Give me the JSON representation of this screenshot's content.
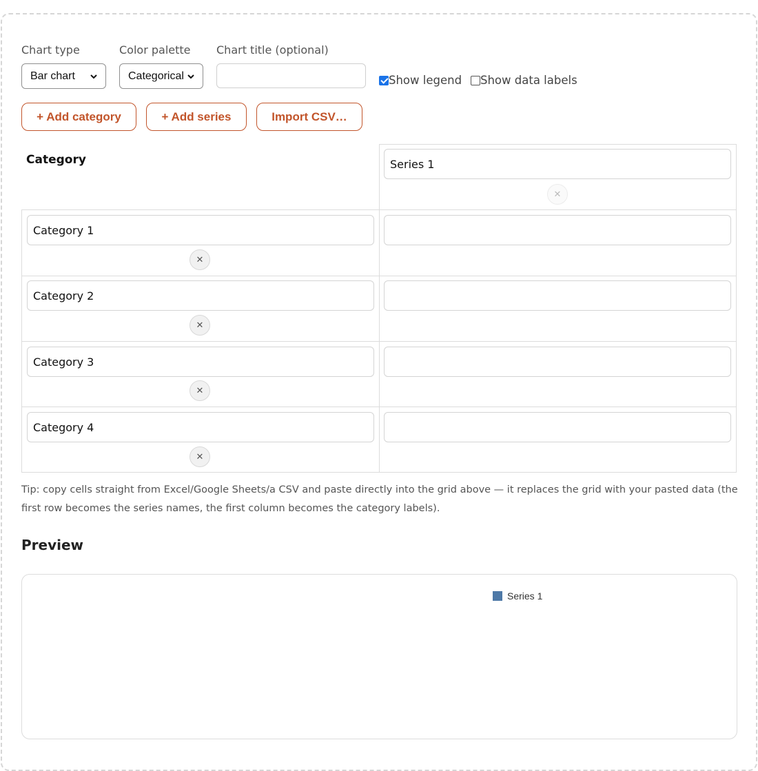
{
  "controls": {
    "chart_type": {
      "label": "Chart type",
      "value": "Bar chart"
    },
    "color_palette": {
      "label": "Color palette",
      "value": "Categorical"
    },
    "chart_title": {
      "label": "Chart title (optional)",
      "value": ""
    },
    "show_legend": {
      "label": "Show legend",
      "checked": true
    },
    "show_data_labels": {
      "label": "Show data labels",
      "checked": false
    }
  },
  "buttons": {
    "add_category": "+ Add category",
    "add_series": "+ Add series",
    "import_csv": "Import CSV…"
  },
  "grid": {
    "header": "Category",
    "series": [
      "Series 1"
    ],
    "rows": [
      {
        "category": "Category 1",
        "value": ""
      },
      {
        "category": "Category 2",
        "value": ""
      },
      {
        "category": "Category 3",
        "value": ""
      },
      {
        "category": "Category 4",
        "value": ""
      }
    ]
  },
  "tip": "Tip: copy cells straight from Excel/Google Sheets/a CSV and paste directly into the grid above — it replaces the grid with your pasted data (the first row becomes the series names, the first column becomes the category labels).",
  "preview": {
    "heading": "Preview",
    "legend": [
      {
        "label": "Series 1",
        "color": "#4e79a7"
      }
    ]
  },
  "colors": {
    "accent": "#c2552b",
    "checkbox": "#1a73e8"
  }
}
